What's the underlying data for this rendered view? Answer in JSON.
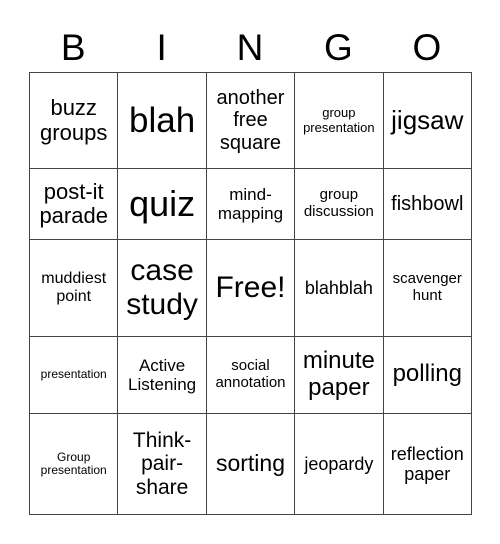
{
  "header": [
    "B",
    "I",
    "N",
    "G",
    "O"
  ],
  "cells": [
    [
      {
        "text": "buzz groups",
        "size": 22
      },
      {
        "text": "blah",
        "size": 35
      },
      {
        "text": "another free square",
        "size": 20
      },
      {
        "text": "group presentation",
        "size": 13
      },
      {
        "text": "jigsaw",
        "size": 26
      }
    ],
    [
      {
        "text": "post-it parade",
        "size": 22
      },
      {
        "text": "quiz",
        "size": 36
      },
      {
        "text": "mind-mapping",
        "size": 17
      },
      {
        "text": "group discussion",
        "size": 15
      },
      {
        "text": "fishbowl",
        "size": 20
      }
    ],
    [
      {
        "text": "muddiest point",
        "size": 16
      },
      {
        "text": "case study",
        "size": 30
      },
      {
        "text": "Free!",
        "size": 30
      },
      {
        "text": "blahblah",
        "size": 18
      },
      {
        "text": "scavenger hunt",
        "size": 15
      }
    ],
    [
      {
        "text": "presentation",
        "size": 12
      },
      {
        "text": "Active Listening",
        "size": 17
      },
      {
        "text": "social annotation",
        "size": 15
      },
      {
        "text": "minute paper",
        "size": 24
      },
      {
        "text": "polling",
        "size": 24
      }
    ],
    [
      {
        "text": "Group presentation",
        "size": 12
      },
      {
        "text": "Think-pair-share",
        "size": 21
      },
      {
        "text": "sorting",
        "size": 23
      },
      {
        "text": "jeopardy",
        "size": 18
      },
      {
        "text": "reflection paper",
        "size": 18
      }
    ]
  ]
}
